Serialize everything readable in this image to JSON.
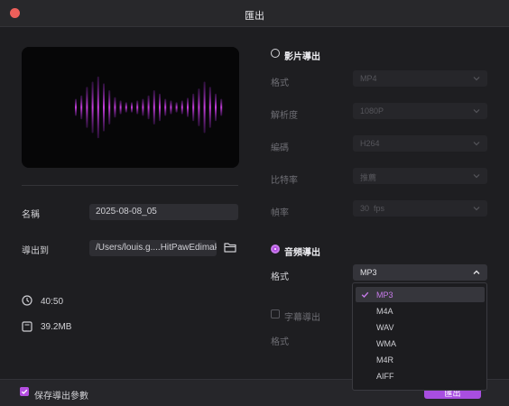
{
  "window": {
    "title": "匯出"
  },
  "preview": {
    "bar_heights": [
      0.25,
      0.35,
      0.6,
      0.75,
      0.9,
      0.7,
      0.5,
      0.3,
      0.2,
      0.15,
      0.15,
      0.2,
      0.25,
      0.35,
      0.5,
      0.4,
      0.25,
      0.2,
      0.15,
      0.2,
      0.28,
      0.4,
      0.55,
      0.75,
      0.6,
      0.4,
      0.25
    ],
    "accent": "#c93fe0"
  },
  "left": {
    "name_label": "名稱",
    "name_value": "2025-08-08_05",
    "export_to_label": "導出到",
    "export_path": "/Users/louis.g....HitPawEdimakor",
    "duration": "40:50",
    "size": "39.2MB"
  },
  "video": {
    "label": "影片導出",
    "rows": [
      {
        "label": "格式",
        "value": "MP4"
      },
      {
        "label": "解析度",
        "value": "1080P"
      },
      {
        "label": "編碼",
        "value": "H264"
      },
      {
        "label": "比特率",
        "value": "推薦"
      },
      {
        "label": "幀率",
        "value": "30  fps"
      }
    ]
  },
  "audio": {
    "label": "音頻導出",
    "format_label": "格式",
    "format_value": "MP3",
    "options": [
      "MP3",
      "M4A",
      "WAV",
      "WMA",
      "M4R",
      "AIFF"
    ],
    "selected": "MP3",
    "subtitle_label": "字幕導出",
    "subtitle_format_label": "格式"
  },
  "footer": {
    "save_params_label": "保存導出參數",
    "export_button": "匯出"
  },
  "colors": {
    "accent": "#b44ee0",
    "close": "#ec5f5a"
  }
}
